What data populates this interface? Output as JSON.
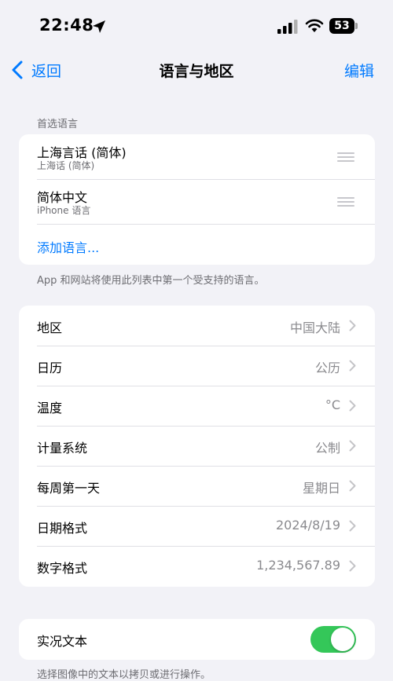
{
  "status_bar": {
    "time": "22:48",
    "battery_level": "53",
    "icons": [
      "location-arrow-icon",
      "cellular-signal-icon",
      "wifi-icon",
      "battery-icon"
    ]
  },
  "nav": {
    "back_label": "返回",
    "title": "语言与地区",
    "edit_label": "编辑",
    "back_icon": "chevron-left-icon"
  },
  "preferred_languages": {
    "header": "首选语言",
    "items": [
      {
        "name": "上海言话 (简体)",
        "subtitle": "上海话 (简体)"
      },
      {
        "name": "简体中文",
        "subtitle": "iPhone 语言"
      }
    ],
    "add_label": "添加语言...",
    "footer": "App 和网站将使用此列表中第一个受支持的语言。"
  },
  "region_settings": [
    {
      "label": "地区",
      "value": "中国大陆"
    },
    {
      "label": "日历",
      "value": "公历"
    },
    {
      "label": "温度",
      "value": "°C"
    },
    {
      "label": "计量系统",
      "value": "公制"
    },
    {
      "label": "每周第一天",
      "value": "星期日"
    },
    {
      "label": "日期格式",
      "value": "2024/8/19"
    },
    {
      "label": "数字格式",
      "value": "1,234,567.89"
    }
  ],
  "live_text": {
    "label": "实况文本",
    "enabled": true,
    "footer": "选择图像中的文本以拷贝或进行操作。"
  },
  "colors": {
    "accent": "#007aff",
    "toggle_on": "#34c759",
    "background": "#f2f2f7"
  }
}
